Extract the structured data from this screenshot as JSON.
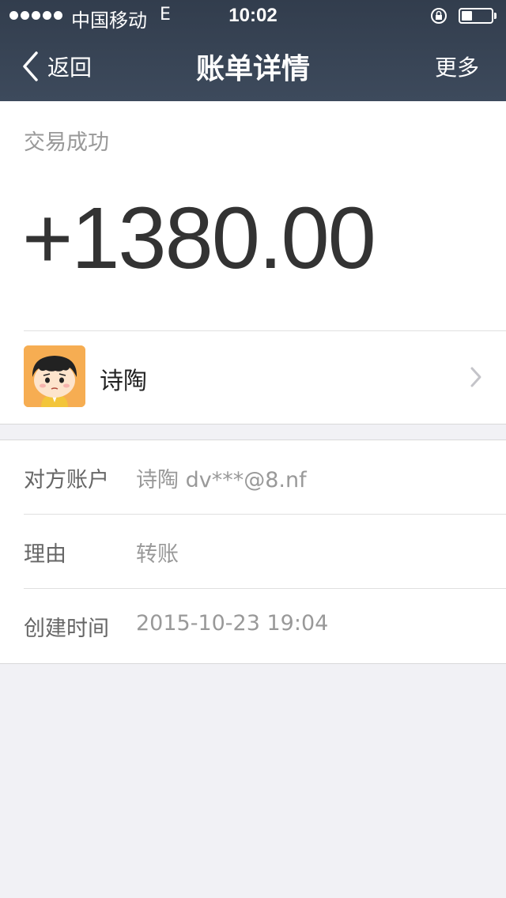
{
  "status_bar": {
    "carrier": "中国移动",
    "network": "E",
    "time": "10:02",
    "battery_level": 0.35
  },
  "nav": {
    "back_label": "返回",
    "title": "账单详情",
    "more_label": "更多"
  },
  "transaction": {
    "status": "交易成功",
    "amount": "+1380.00"
  },
  "payer": {
    "name": "诗陶"
  },
  "details": [
    {
      "label": "对方账户",
      "value": "诗陶 dv***@8.nf"
    },
    {
      "label": "理由",
      "value": "转账"
    },
    {
      "label": "创建时间",
      "value": "2015-10-23 19:04"
    }
  ],
  "icons": {
    "back": "chevron-left-icon",
    "disclosure": "chevron-right-icon",
    "rotation_lock": "rotation-lock-icon",
    "battery": "battery-icon"
  },
  "colors": {
    "nav_bar": "#363f4e",
    "background": "#f1f1f5",
    "amount_text": "#333333",
    "secondary_text": "#999999"
  }
}
